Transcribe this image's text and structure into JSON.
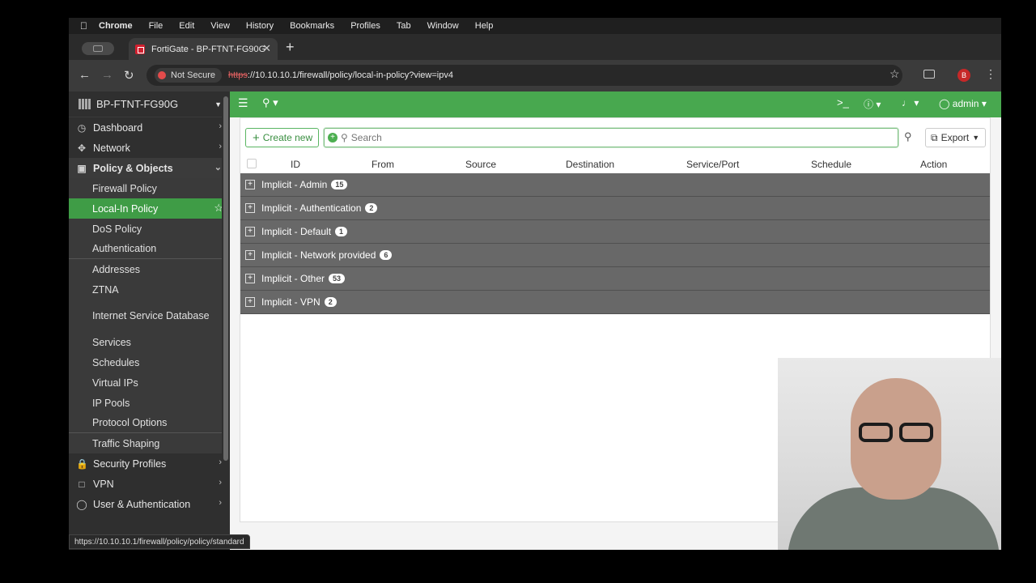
{
  "menubar": {
    "app": "Chrome",
    "items": [
      "File",
      "Edit",
      "View",
      "History",
      "Bookmarks",
      "Profiles",
      "Tab",
      "Window",
      "Help"
    ]
  },
  "browser": {
    "tab_title": "FortiGate - BP-FTNT-FG90G",
    "security_label": "Not Secure",
    "url_scheme": "https",
    "url_rest": "://10.10.10.1/firewall/policy/local-in-policy?view=ipv4",
    "profile_initial": "B",
    "status_url": "https://10.10.10.1/firewall/policy/policy/standard"
  },
  "sidebar": {
    "device": "BP-FTNT-FG90G",
    "top_items": [
      {
        "label": "Dashboard",
        "icon": "gauge-icon"
      },
      {
        "label": "Network",
        "icon": "network-icon"
      }
    ],
    "section": {
      "label": "Policy & Objects",
      "icon": "policy-icon"
    },
    "sub_items": [
      "Firewall Policy",
      "Local-In Policy",
      "DoS Policy",
      "Authentication",
      "Addresses",
      "ZTNA",
      "Internet Service Database",
      "Services",
      "Schedules",
      "Virtual IPs",
      "IP Pools",
      "Protocol Options",
      "Traffic Shaping"
    ],
    "bottom_items": [
      {
        "label": "Security Profiles",
        "icon": "lock-icon"
      },
      {
        "label": "VPN",
        "icon": "laptop-icon"
      },
      {
        "label": "User & Authentication",
        "icon": "user-icon"
      }
    ]
  },
  "topbar": {
    "user": "admin"
  },
  "toolbar": {
    "create_label": "Create new",
    "search_placeholder": "Search",
    "export_label": "Export"
  },
  "table": {
    "columns": [
      "ID",
      "From",
      "Source",
      "Destination",
      "Service/Port",
      "Schedule",
      "Action"
    ],
    "groups": [
      {
        "name": "Implicit - Admin",
        "count": "15"
      },
      {
        "name": "Implicit - Authentication",
        "count": "2"
      },
      {
        "name": "Implicit - Default",
        "count": "1"
      },
      {
        "name": "Implicit - Network provided",
        "count": "6"
      },
      {
        "name": "Implicit - Other",
        "count": "53"
      },
      {
        "name": "Implicit - VPN",
        "count": "2"
      }
    ]
  },
  "colors": {
    "fortigate_green": "#48a84f",
    "active_item": "#3f9c46",
    "group_row": "#686868"
  }
}
